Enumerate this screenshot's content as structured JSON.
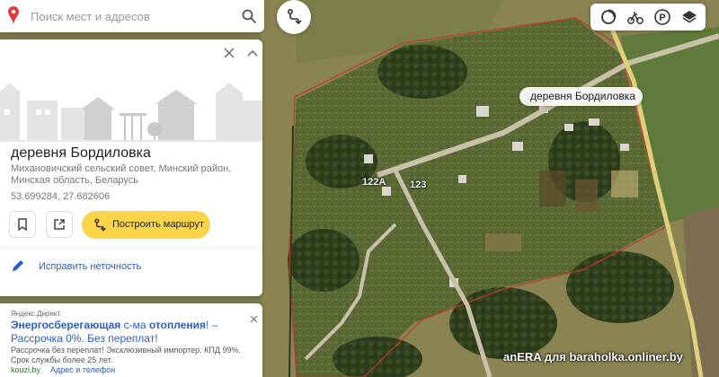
{
  "search": {
    "placeholder": "Поиск мест и адресов",
    "value": ""
  },
  "map": {
    "place_label": "деревня Бордиловка",
    "house_labels": [
      "122А",
      "123"
    ]
  },
  "toolbar": {
    "icons": [
      "traffic-icon",
      "bicycle-icon",
      "parking-icon",
      "layers-icon"
    ],
    "parking_letter": "P"
  },
  "card": {
    "title": "деревня Бордиловка",
    "address": "Михановичский сельский совет, Минский район, Минская область, Беларусь",
    "coordinates": "53.699284, 27.682606",
    "route_button": "Построить маршрут",
    "edit_link": "Исправить неточность"
  },
  "ad": {
    "label": "Яндекс.Директ",
    "title_part1": "Энергосберегающая",
    "title_part2": " с-ма ",
    "title_part3": "отопления",
    "title_part4": "! – Рассрочка 0%. Без переплат!",
    "body": "Рассрочка без переплат! Эксклюзивный импортер. КПД 99%. Срок службы более 25 лет.",
    "domain": "kouzi.by",
    "link": "Адрес и телефон"
  },
  "watermark": "anERA для baraholka.onliner.by",
  "colors": {
    "accent_yellow": "#fcd44a",
    "link_blue": "#2d5dc6",
    "pin_red": "#e53935",
    "boundary_red": "#c0392b"
  }
}
